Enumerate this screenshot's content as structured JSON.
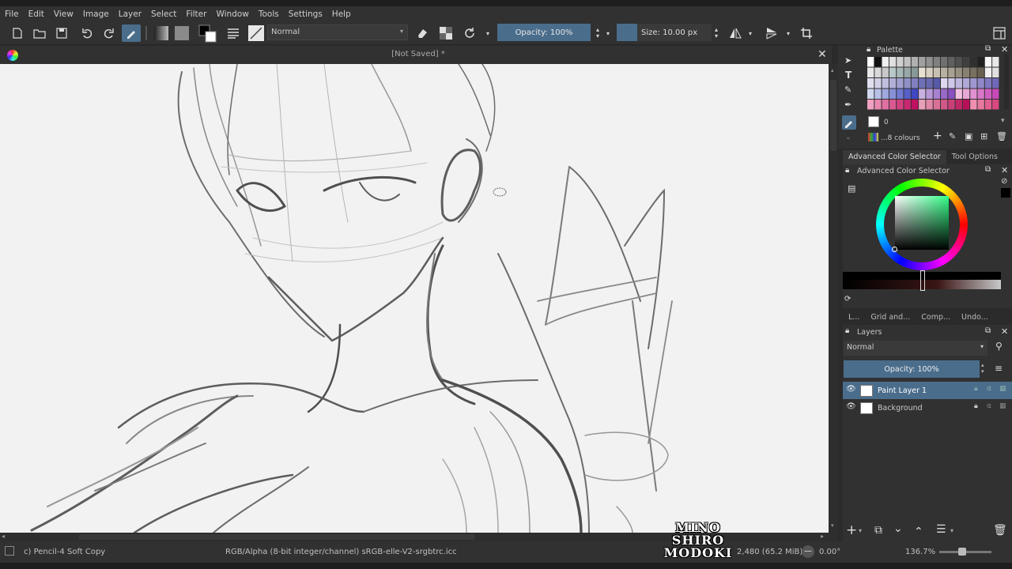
{
  "menu": [
    "File",
    "Edit",
    "View",
    "Image",
    "Layer",
    "Select",
    "Filter",
    "Window",
    "Tools",
    "Settings",
    "Help"
  ],
  "toolbar": {
    "blend_mode": "Normal",
    "opacity": "Opacity: 100%",
    "size": "Size: 10.00 px"
  },
  "document": {
    "title": "[Not Saved]  *"
  },
  "palette": {
    "title": "Palette",
    "index": "0",
    "colour_set": "...8 colours"
  },
  "docker_tabs": [
    "Advanced Color Selector",
    "Tool Options"
  ],
  "color_selector": {
    "title": "Advanced Color Selector"
  },
  "lower_tabs": [
    "L...",
    "Grid and...",
    "Comp...",
    "Undo..."
  ],
  "layers": {
    "title": "Layers",
    "blend_mode": "Normal",
    "opacity": "Opacity:  100%",
    "items": [
      {
        "name": "Paint Layer 1",
        "active": true
      },
      {
        "name": "Background",
        "active": false
      }
    ]
  },
  "status": {
    "brush": "c) Pencil-4 Soft Copy",
    "color_space": "RGB/Alpha (8-bit integer/channel)  sRGB-elle-V2-srgbtrc.icc",
    "memory": "2,480 (65.2 MiB)",
    "rotation": "0.00°",
    "zoom": "136.7%"
  },
  "watermark": [
    "MINO",
    "SHIRO",
    "MODOKI"
  ],
  "colors": {
    "accent": "#4a6d8c",
    "panel": "#313131",
    "canvas": "#f2f2f2"
  }
}
